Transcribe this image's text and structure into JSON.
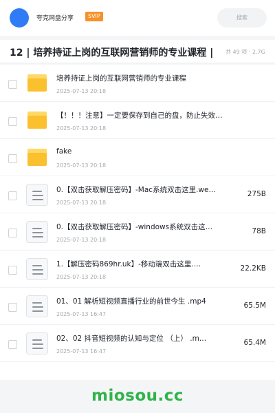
{
  "header": {
    "app_name": "夸克网盘分享",
    "vip_badge": "SVIP",
    "search_placeholder": "搜索"
  },
  "folder": {
    "title": "12 | 培养持证上岗的互联网营销师的专业课程 |",
    "meta": "共 49 项 · 2.7G"
  },
  "files": [
    {
      "type": "folder",
      "name": "培养持证上岗的互联网营销师的专业课程",
      "date": "2025-07-13 20:18",
      "size": ""
    },
    {
      "type": "folder",
      "name": "【！！！注意】一定要保存到自己的盘，防止失效！！！",
      "date": "2025-07-13 20:18",
      "size": ""
    },
    {
      "type": "folder",
      "name": "fake",
      "date": "2025-07-13 20:18",
      "size": ""
    },
    {
      "type": "file",
      "name": "0.【双击获取解压密码】-Mac系统双击这里.we…",
      "date": "2025-07-13 20:18",
      "size": "275B"
    },
    {
      "type": "file",
      "name": "0.【双击获取解压密码】-windows系统双击这…",
      "date": "2025-07-13 20:18",
      "size": "78B"
    },
    {
      "type": "file",
      "name": "1.【解压密码869hr.uk】-移动端双击这里.…",
      "date": "2025-07-13 20:18",
      "size": "22.2KB"
    },
    {
      "type": "file",
      "name": "01、01 解析短视频直播行业的前世今生  .mp4",
      "date": "2025-07-13 16:47",
      "size": "65.5M"
    },
    {
      "type": "file",
      "name": "02、02 抖音短视频的认知与定位 （上）  .m…",
      "date": "2025-07-13 16:47",
      "size": "65.4M"
    }
  ],
  "watermark": "miosou.cc",
  "colors": {
    "accent": "#2f7cf6",
    "vip": "#f7912b",
    "folder": "#fbc02d",
    "watermark": "#2fb34a"
  }
}
